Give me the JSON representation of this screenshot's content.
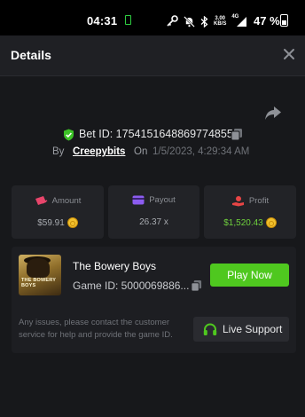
{
  "status_bar": {
    "time": "04:31",
    "net_speed_value": "3.00",
    "net_speed_unit": "KB/S",
    "network_type": "4G",
    "battery_percent": "47 %"
  },
  "header": {
    "title": "Details"
  },
  "bet": {
    "id_label": "Bet ID: 1754151648869774855",
    "by_label": "By",
    "user": "Creepybits",
    "on_label": "On",
    "date": "1/5/2023, 4:29:34 AM"
  },
  "stats": [
    {
      "label": "Amount",
      "value": "$59.91",
      "icon": "wallet-arrow-icon",
      "color": "#e8456b"
    },
    {
      "label": "Payout",
      "value": "26.37 x",
      "icon": "card-icon",
      "color": "#8c5cf0"
    },
    {
      "label": "Profit",
      "value": "$1,520.43",
      "icon": "hand-coin-icon",
      "color": "#e84545"
    }
  ],
  "game": {
    "thumbnail_text": "THE BOWERY BOYS",
    "name": "The Bowery Boys",
    "id_label": "Game ID: 5000069886...",
    "play_button": "Play Now",
    "support_text": "Any issues, please contact the customer service for help and provide the game ID.",
    "support_button": "Live Support"
  },
  "colors": {
    "accent_green": "#4fc81f",
    "profit_green": "#6fd13d",
    "background": "#17181b"
  }
}
